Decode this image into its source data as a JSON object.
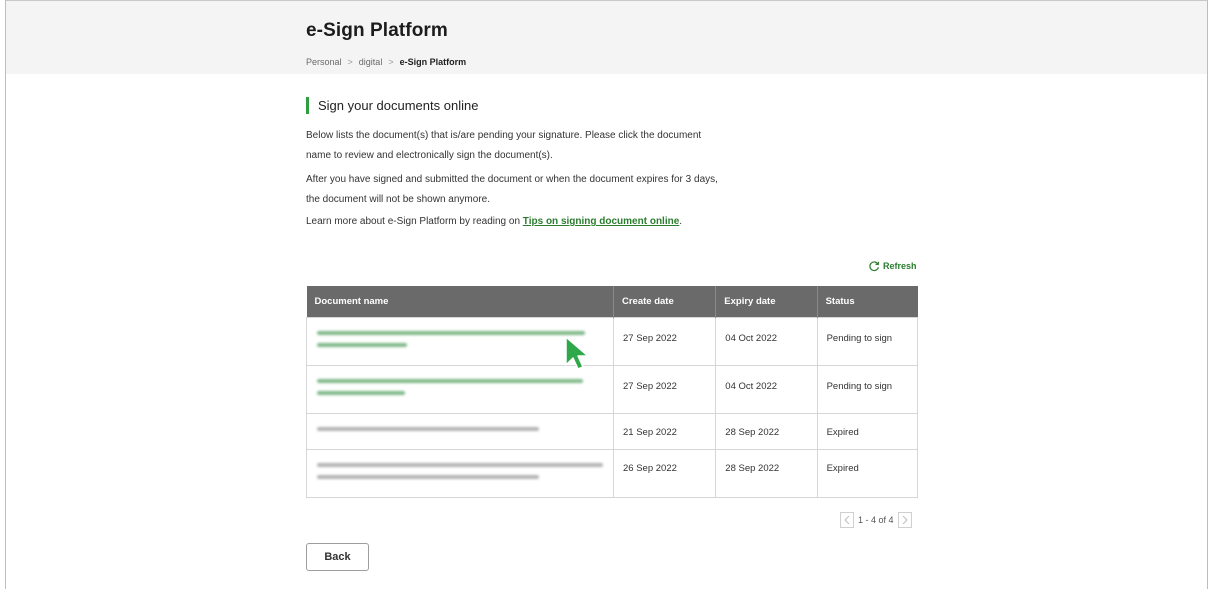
{
  "header": {
    "title": "e-Sign Platform",
    "breadcrumb": [
      "Personal",
      "digital",
      "e-Sign Platform"
    ]
  },
  "intro": {
    "heading": "Sign your documents online",
    "para1": "Below lists the document(s) that is/are pending your signature. Please click the document name to review and electronically sign the document(s).",
    "para2": "After you have signed and submitted the document or when the document expires for 3 days, the document will not be shown anymore.",
    "para3_prefix": "Learn more about e-Sign Platform by reading on ",
    "para3_link": "Tips on signing document online",
    "para3_suffix": "."
  },
  "refresh_label": "Refresh",
  "table": {
    "headers": [
      "Document name",
      "Create date",
      "Expiry date",
      "Status"
    ],
    "rows": [
      {
        "name_lines": 2,
        "name_style": "link",
        "create": "27 Sep 2022",
        "expiry": "04 Oct 2022",
        "status": "Pending to sign"
      },
      {
        "name_lines": 2,
        "name_style": "link",
        "create": "27 Sep 2022",
        "expiry": "04 Oct 2022",
        "status": "Pending to sign"
      },
      {
        "name_lines": 1,
        "name_style": "plain",
        "create": "21 Sep 2022",
        "expiry": "28 Sep 2022",
        "status": "Expired"
      },
      {
        "name_lines": 2,
        "name_style": "plain",
        "create": "26 Sep 2022",
        "expiry": "28 Sep 2022",
        "status": "Expired"
      }
    ]
  },
  "pager": {
    "count_label": "1 - 4 of 4"
  },
  "back_label": "Back",
  "colors": {
    "accent": "#2e9e3e",
    "link": "#2a7d2e",
    "table_header": "#6a6a6a"
  },
  "icons": [
    "refresh-icon",
    "chevron-left-icon",
    "chevron-right-icon",
    "mouse-cursor-icon"
  ]
}
